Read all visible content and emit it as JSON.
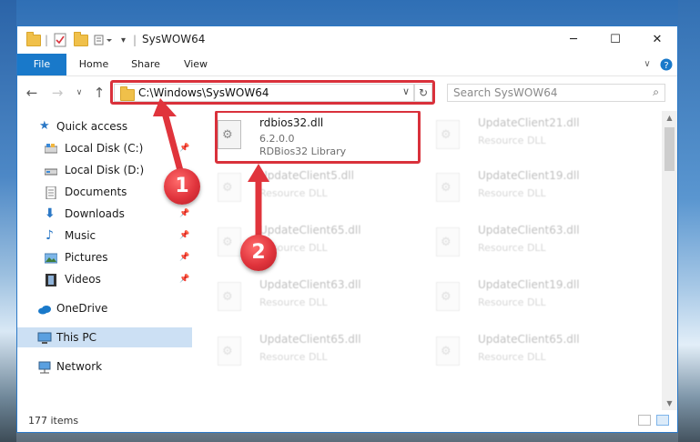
{
  "window": {
    "title": "SysWOW64"
  },
  "ribbon": {
    "tabs": [
      "File",
      "Home",
      "Share",
      "View"
    ]
  },
  "address_bar": {
    "path": "C:\\Windows\\SysWOW64"
  },
  "search": {
    "placeholder": "Search SysWOW64"
  },
  "sidebar": {
    "quick_access": "Quick access",
    "items": [
      {
        "label": "Local Disk (C:)",
        "icon": "drive-icon",
        "pinned": true
      },
      {
        "label": "Local Disk (D:)",
        "icon": "drive-icon",
        "pinned": false
      },
      {
        "label": "Documents",
        "icon": "documents-icon",
        "pinned": true
      },
      {
        "label": "Downloads",
        "icon": "download-arrow-icon",
        "pinned": true
      },
      {
        "label": "Music",
        "icon": "music-note-icon",
        "pinned": true
      },
      {
        "label": "Pictures",
        "icon": "pictures-icon",
        "pinned": true
      },
      {
        "label": "Videos",
        "icon": "film-icon",
        "pinned": true
      }
    ],
    "onedrive": "OneDrive",
    "this_pc": "This PC",
    "network": "Network"
  },
  "files": {
    "highlighted": {
      "name": "rdbios32.dll",
      "version": "6.2.0.0",
      "description": "RDBios32 Library"
    },
    "left_column": [
      {
        "name": "UpdateClient5.dll",
        "description": "Resource DLL"
      },
      {
        "name": "UpdateClient65.dll",
        "description": "Resource DLL"
      },
      {
        "name": "UpdateClient63.dll",
        "description": "Resource DLL"
      },
      {
        "name": "UpdateClient65.dll",
        "description": "Resource DLL"
      }
    ],
    "right_column": [
      {
        "name": "UpdateClient21.dll",
        "description": "Resource DLL"
      },
      {
        "name": "UpdateClient19.dll",
        "description": "Resource DLL"
      },
      {
        "name": "UpdateClient63.dll",
        "description": "Resource DLL"
      },
      {
        "name": "UpdateClient19.dll",
        "description": "Resource DLL"
      },
      {
        "name": "UpdateClient65.dll",
        "description": "Resource DLL"
      }
    ]
  },
  "status": {
    "item_count": "177 items"
  },
  "callouts": {
    "one": "1",
    "two": "2"
  },
  "colors": {
    "accent": "#1979ca",
    "highlight_red": "#d9313b",
    "selected": "#cce0f4"
  }
}
